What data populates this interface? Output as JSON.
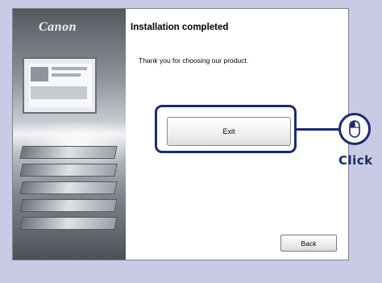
{
  "brand": {
    "logo_text": "Canon"
  },
  "header": {
    "title": "Installation completed"
  },
  "main": {
    "message": "Thank you for choosing our product."
  },
  "buttons": {
    "exit_label": "Exit",
    "back_label": "Back"
  },
  "callout": {
    "label": "Click",
    "icon": "mouse-icon",
    "color": "#1c2b68"
  }
}
